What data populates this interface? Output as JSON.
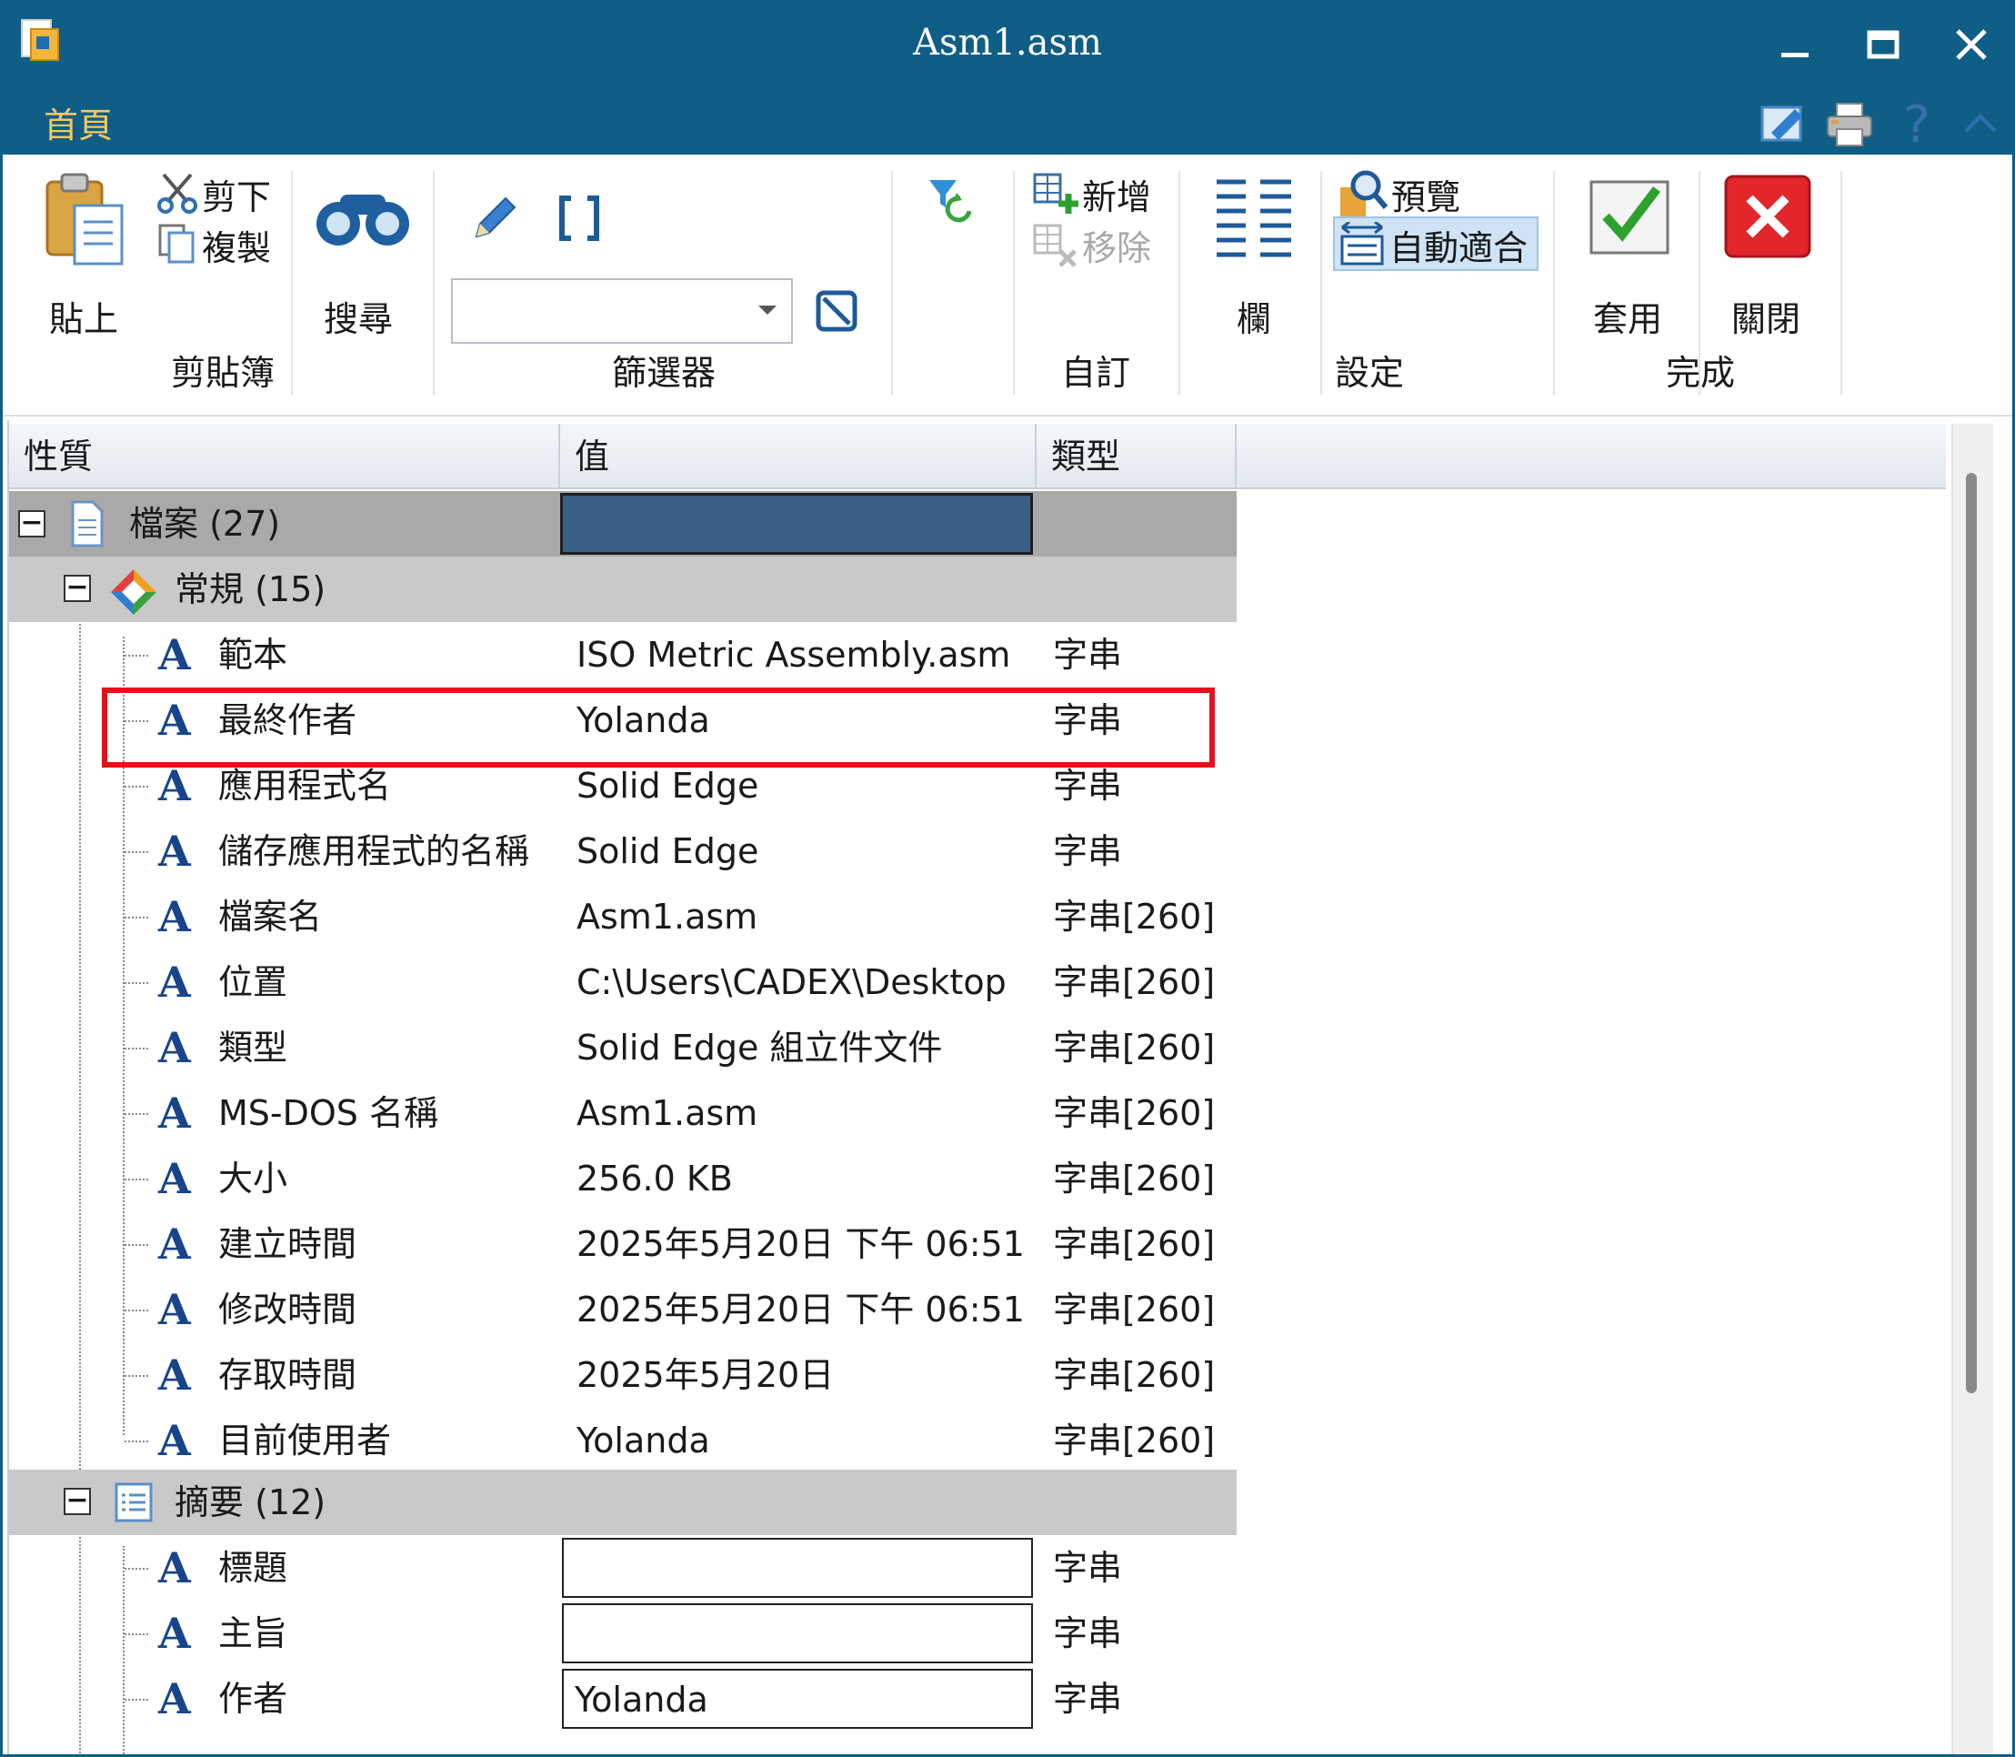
{
  "window": {
    "title": "Asm1.asm"
  },
  "tabs": {
    "home": "首頁"
  },
  "ribbon": {
    "paste": "貼上",
    "cut": "剪下",
    "copy": "複製",
    "clipboard_group": "剪貼簿",
    "search": "搜尋",
    "filter_value": "",
    "filter_group": "篩選器",
    "add": "新增",
    "remove": "移除",
    "custom_group": "自訂",
    "columns": "欄",
    "preview": "預覽",
    "autofit": "自動適合",
    "settings_group": "設定",
    "apply": "套用",
    "close": "關閉",
    "done_group": "完成"
  },
  "grid": {
    "headers": [
      "性質",
      "值",
      "類型"
    ],
    "file": {
      "label": "檔案 (27)"
    },
    "general": {
      "label": "常規 (15)",
      "rows": [
        {
          "name": "範本",
          "value": "ISO Metric Assembly.asm",
          "type": "字串"
        },
        {
          "name": "最終作者",
          "value": "Yolanda",
          "type": "字串"
        },
        {
          "name": "應用程式名",
          "value": "Solid Edge",
          "type": "字串"
        },
        {
          "name": "儲存應用程式的名稱",
          "value": "Solid Edge",
          "type": "字串"
        },
        {
          "name": "檔案名",
          "value": "Asm1.asm",
          "type": "字串[260]"
        },
        {
          "name": "位置",
          "value": "C:\\Users\\CADEX\\Desktop",
          "type": "字串[260]"
        },
        {
          "name": "類型",
          "value": "Solid Edge 組立件文件",
          "type": "字串[260]"
        },
        {
          "name": "MS-DOS 名稱",
          "value": "Asm1.asm",
          "type": "字串[260]"
        },
        {
          "name": "大小",
          "value": "256.0 KB",
          "type": "字串[260]"
        },
        {
          "name": "建立時間",
          "value": "2025年5月20日  下午 06:51",
          "type": "字串[260]"
        },
        {
          "name": "修改時間",
          "value": "2025年5月20日  下午 06:51",
          "type": "字串[260]"
        },
        {
          "name": "存取時間",
          "value": "2025年5月20日",
          "type": "字串[260]"
        },
        {
          "name": "目前使用者",
          "value": "Yolanda",
          "type": "字串[260]"
        }
      ]
    },
    "summary": {
      "label": "摘要 (12)",
      "rows": [
        {
          "name": "標題",
          "value": "",
          "type": "字串"
        },
        {
          "name": "主旨",
          "value": "",
          "type": "字串"
        },
        {
          "name": "作者",
          "value": "Yolanda",
          "type": "字串"
        }
      ]
    }
  },
  "colors": {
    "titlebar": "#0f5e86",
    "tab_active": "#f6c85f",
    "highlight": "#e3121b",
    "selected_value": "#3a5f85"
  }
}
